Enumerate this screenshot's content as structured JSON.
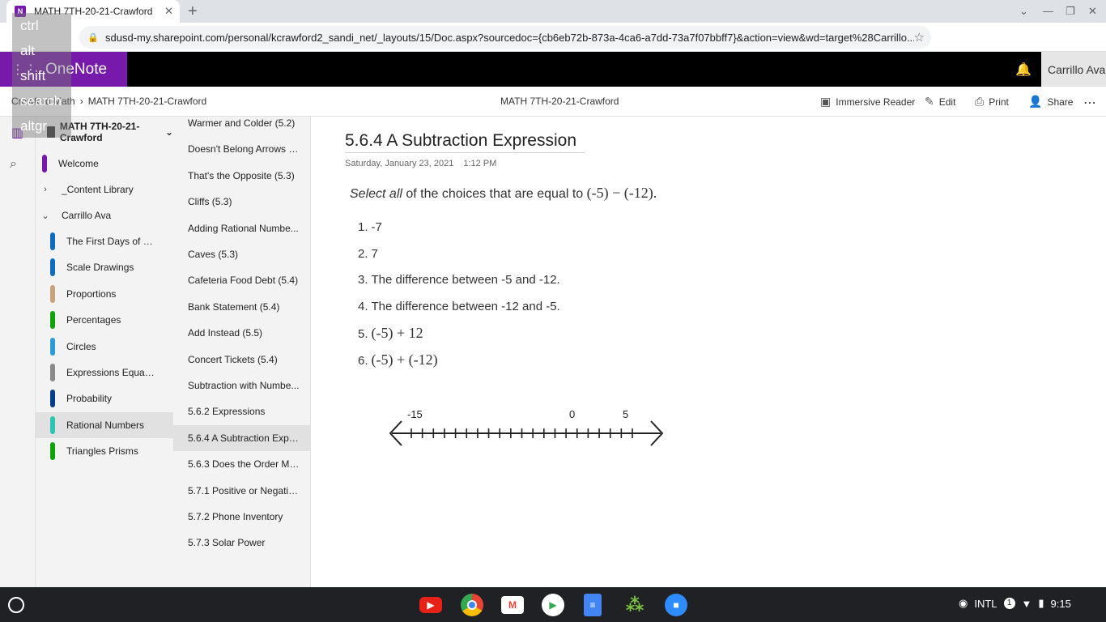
{
  "browser": {
    "tab_title": "MATH 7TH-20-21-Crawford",
    "favicon_letter": "N",
    "url": "sdusd-my.sharepoint.com/personal/kcrawford2_sandi_net/_layouts/15/Doc.aspx?sourcedoc={cb6eb72b-873a-4ca6-a7dd-73a7f07bbff7}&action=view&wd=target%28Carrillo..."
  },
  "app": {
    "name": "OneNote",
    "user": "Carrillo Ava"
  },
  "ribbon": {
    "breadcrumb_root": "Crawford Math",
    "breadcrumb_sep": "›",
    "breadcrumb_notebook": "MATH 7TH-20-21-Crawford",
    "doc_title": "MATH 7TH-20-21-Crawford",
    "immersive_reader": "Immersive Reader",
    "edit": "Edit",
    "print": "Print",
    "share": "Share",
    "more": "⋯"
  },
  "notebook": {
    "name": "MATH 7TH-20-21-Crawford",
    "sections": [
      {
        "label": "Welcome",
        "color": "#7719aa"
      },
      {
        "label": "_Content Library",
        "color": ""
      },
      {
        "label": "Carrillo Ava",
        "color": ""
      },
      {
        "label": "The First Days of Sc...",
        "color": "#0f6cbd"
      },
      {
        "label": "Scale Drawings",
        "color": "#0f6cbd"
      },
      {
        "label": "Proportions",
        "color": "#c8a27a"
      },
      {
        "label": "Percentages",
        "color": "#13a10e"
      },
      {
        "label": "Circles",
        "color": "#2e9ad6"
      },
      {
        "label": "Expressions Equatio...",
        "color": "#8a8a8a"
      },
      {
        "label": "Probability",
        "color": "#003f88"
      },
      {
        "label": "Rational Numbers",
        "color": "#2fc4b2"
      },
      {
        "label": "Triangles Prisms",
        "color": "#13a10e"
      }
    ]
  },
  "pages": [
    "Warmer and Colder (5.2)",
    "Doesn't Belong Arrows (...",
    "That's the Opposite (5.3)",
    "Cliffs (5.3)",
    "Adding Rational Numbe...",
    "Caves (5.3)",
    "Cafeteria Food Debt (5.4)",
    "Bank Statement (5.4)",
    "Add Instead (5.5)",
    "Concert Tickets (5.4)",
    "Subtraction with Numbe...",
    "5.6.2 Expressions",
    "5.6.4 A Subtraction Expr...",
    "5.6.3 Does the Order Ma...",
    "5.7.1 Positive or Negative?",
    "5.7.2 Phone Inventory",
    "5.7.3 Solar Power"
  ],
  "page": {
    "title": "5.6.4 A Subtraction Expression",
    "date": "Saturday, January 23, 2021",
    "time": "1:12 PM",
    "prompt_italic": "Select all",
    "prompt_rest": " of the choices that are equal to ",
    "prompt_expr": "(-5) − (-12).",
    "choices": [
      {
        "num": "1.",
        "text": "-7"
      },
      {
        "num": "2.",
        "text": "7"
      },
      {
        "num": "3.",
        "text": "The difference between -5 and -12."
      },
      {
        "num": "4.",
        "text": "The difference between -12 and -5."
      },
      {
        "num": "5.",
        "text": "(-5) + 12"
      },
      {
        "num": "6.",
        "text": "(-5) + (-12)"
      }
    ],
    "numberline": {
      "labels": [
        "-15",
        "0",
        "5"
      ],
      "min": -15,
      "max": 5
    }
  },
  "keyboard_overlay": [
    "ctrl",
    "alt",
    "shift",
    "search",
    "altgr"
  ],
  "shelf": {
    "ime": "INTL",
    "notif_count": "1",
    "time": "9:15"
  }
}
